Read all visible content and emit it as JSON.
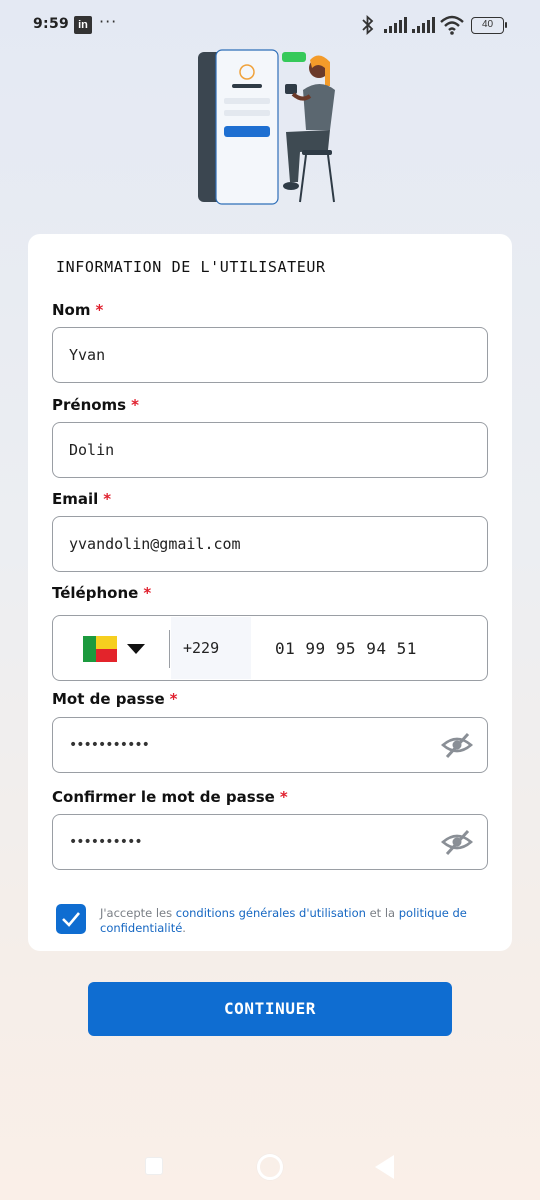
{
  "status_bar": {
    "time": "9:59",
    "app_badge": "in",
    "more": "···",
    "battery": "40"
  },
  "form": {
    "title": "INFORMATION DE L'UTILISATEUR",
    "required_marker": "*",
    "fields": {
      "nom": {
        "label": "Nom",
        "value": "Yvan"
      },
      "prenoms": {
        "label": "Prénoms",
        "value": "Dolin"
      },
      "email": {
        "label": "Email",
        "value": "yvandolin@gmail.com"
      },
      "telephone": {
        "label": "Téléphone",
        "country_code": "+229",
        "value": "01 99 95 94 51",
        "country_flag": "benin-flag-icon"
      },
      "password": {
        "label": "Mot de passe",
        "masked_value": "•••••••••••"
      },
      "confirm_password": {
        "label": "Confirmer le mot de passe",
        "masked_value": "••••••••••"
      }
    },
    "terms": {
      "checked": true,
      "prefix": "J'accepte les ",
      "link1": "conditions générales d'utilisation",
      "middle": " et la ",
      "link2": "politique de confidentialité",
      "suffix": "."
    },
    "submit_label": "CONTINUER"
  },
  "colors": {
    "primary": "#0f6dd1",
    "required": "#e0202e",
    "link": "#1667c2"
  }
}
